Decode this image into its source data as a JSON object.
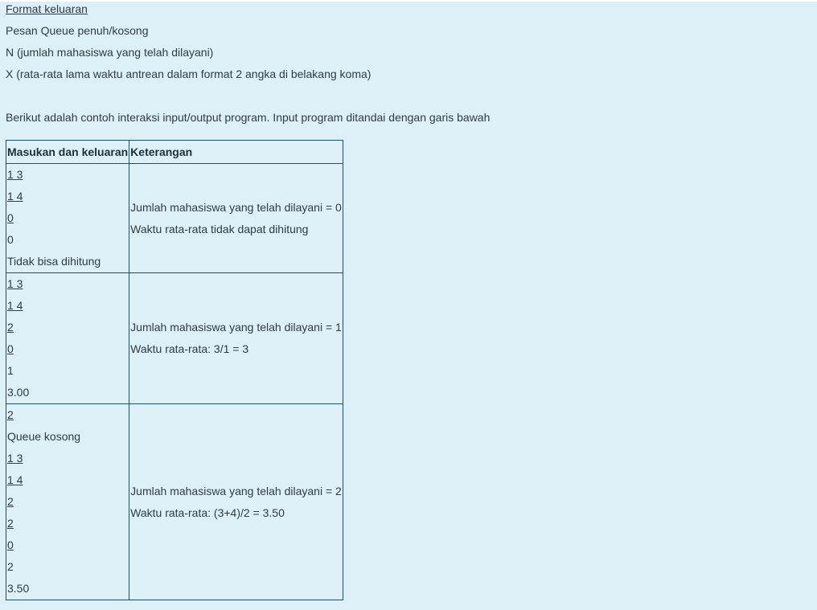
{
  "intro": {
    "title": "Format keluaran",
    "lines": [
      "Pesan Queue penuh/kosong",
      "N (jumlah mahasiswa yang telah dilayani)",
      "X (rata-rata lama waktu antrean dalam format 2 angka di belakang koma)"
    ],
    "description": "Berikut adalah contoh interaksi input/output program. Input program ditandai dengan garis bawah"
  },
  "table": {
    "headers": [
      "Masukan dan keluaran",
      "Keterangan"
    ],
    "rows": [
      {
        "io": [
          "1 3",
          "1 4",
          "0",
          "0",
          "Tidak bisa dihitung"
        ],
        "notes": [
          "Jumlah mahasiswa yang telah dilayani = 0",
          "Waktu rata-rata tidak dapat dihitung"
        ]
      },
      {
        "io": [
          "1 3",
          "1 4",
          "2",
          "0",
          "1",
          "3.00"
        ],
        "notes": [
          "Jumlah mahasiswa yang telah dilayani = 1",
          "Waktu rata-rata: 3/1 = 3"
        ]
      },
      {
        "io": [
          "2",
          "Queue kosong",
          "1 3",
          "1 4",
          "2",
          "2",
          "0",
          "2",
          "3.50"
        ],
        "notes": [
          "Jumlah mahasiswa yang telah dilayani = 2",
          "Waktu rata-rata: (3+4)/2 = 3.50"
        ]
      }
    ]
  }
}
